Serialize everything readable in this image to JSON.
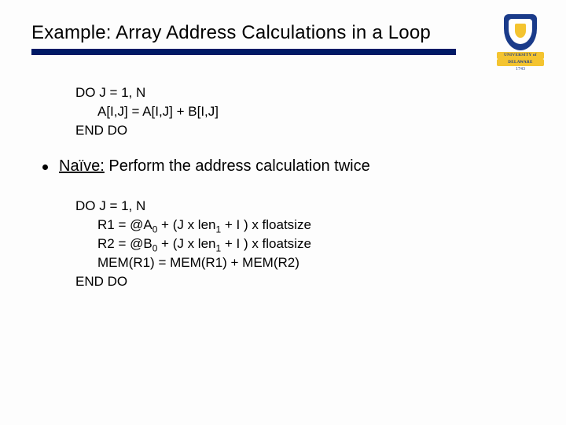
{
  "title": "Example: Array Address Calculations in a Loop",
  "logo": {
    "line1": "UNIVERSITY of",
    "line2": "DELAWARE",
    "year": "1743"
  },
  "code1": {
    "l1": "DO J = 1, N",
    "l2": "A[I,J] = A[I,J] + B[I,J]",
    "l3": "END DO"
  },
  "bullet": {
    "lead": "Naïve:",
    "rest": " Perform the address calculation twice"
  },
  "code2": {
    "l1": "DO J = 1, N",
    "l2a": "R1 = @A",
    "l2s": "0",
    "l2b": " + (J x len",
    "l2s2": "1",
    "l2c": " + I ) x floatsize",
    "l3a": "R2 = @B",
    "l3s": "0",
    "l3b": " + (J x len",
    "l3s2": "1",
    "l3c": " + I ) x floatsize",
    "l4": "MEM(R1) = MEM(R1) + MEM(R2)",
    "l5": "END DO"
  }
}
